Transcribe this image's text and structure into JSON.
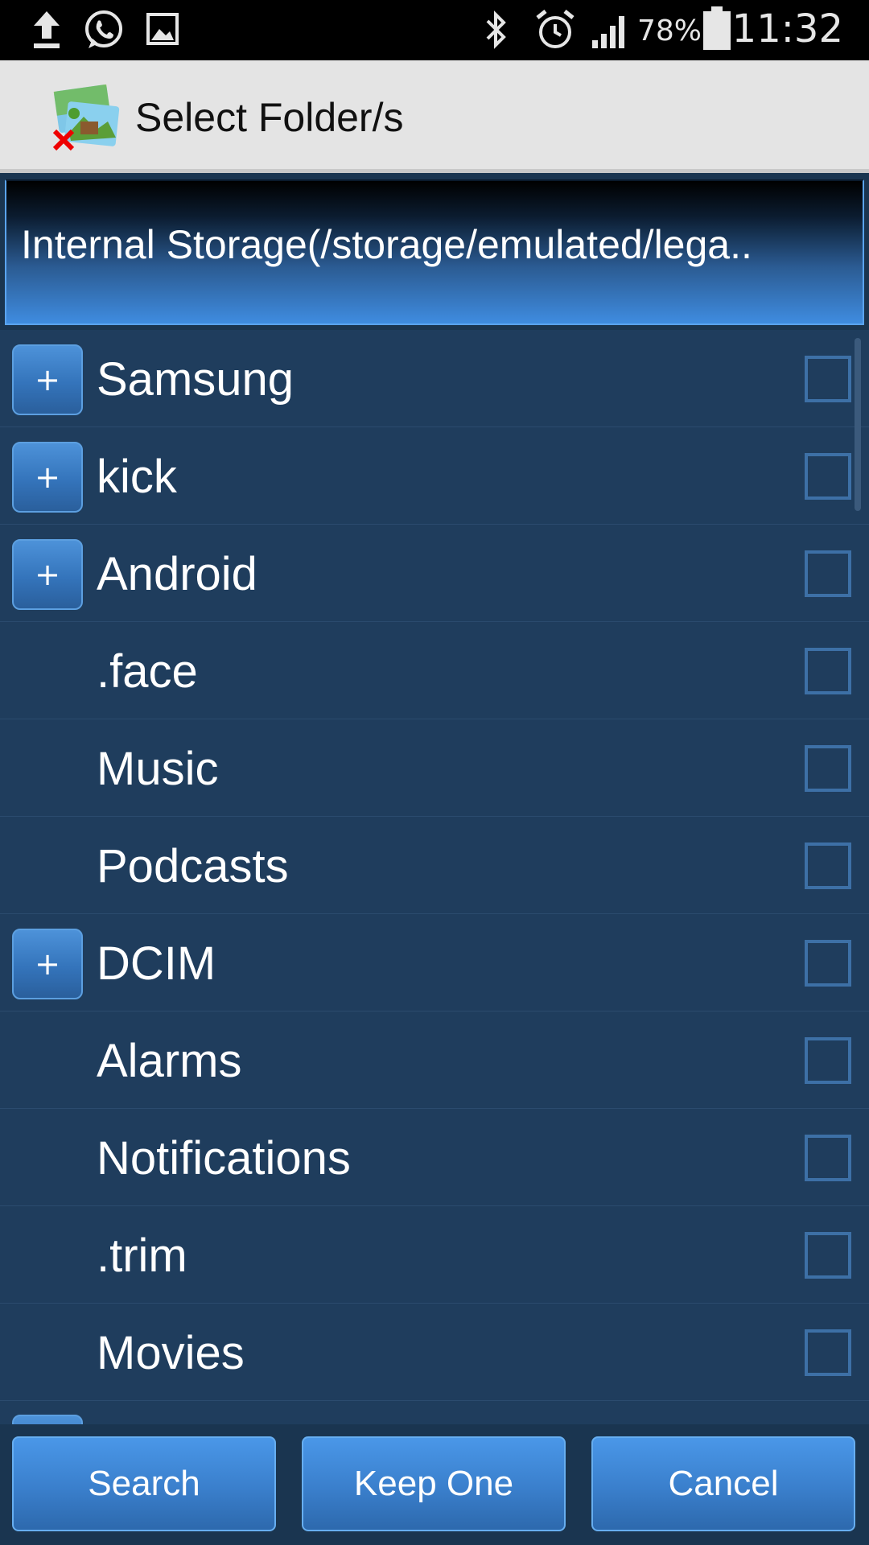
{
  "status_bar": {
    "icons_left": [
      "upload-icon",
      "whatsapp-icon",
      "image-icon"
    ],
    "icons_right": [
      "bluetooth-icon",
      "alarm-icon",
      "signal-icon",
      "battery-icon"
    ],
    "battery_percent": "78%",
    "time": "11:32"
  },
  "title_bar": {
    "title": "Select Folder/s"
  },
  "path_header": {
    "path": "Internal Storage(/storage/emulated/lega.."
  },
  "folders": [
    {
      "name": "Samsung",
      "expand_label": "+"
    },
    {
      "name": "kick",
      "expand_label": "+"
    },
    {
      "name": "Android",
      "expand_label": "+"
    },
    {
      "name": ".face",
      "expand_label": null
    },
    {
      "name": "Music",
      "expand_label": null
    },
    {
      "name": "Podcasts",
      "expand_label": null
    },
    {
      "name": "DCIM",
      "expand_label": "+"
    },
    {
      "name": "Alarms",
      "expand_label": null
    },
    {
      "name": "Notifications",
      "expand_label": null
    },
    {
      "name": ".trim",
      "expand_label": null
    },
    {
      "name": "Movies",
      "expand_label": null
    }
  ],
  "buttons": {
    "search": "Search",
    "keep_one": "Keep One",
    "cancel": "Cancel"
  },
  "colors": {
    "list_background": "#1f3d5d",
    "button_blue": "#3a7fcc",
    "checkbox_border": "#3d70a6"
  }
}
